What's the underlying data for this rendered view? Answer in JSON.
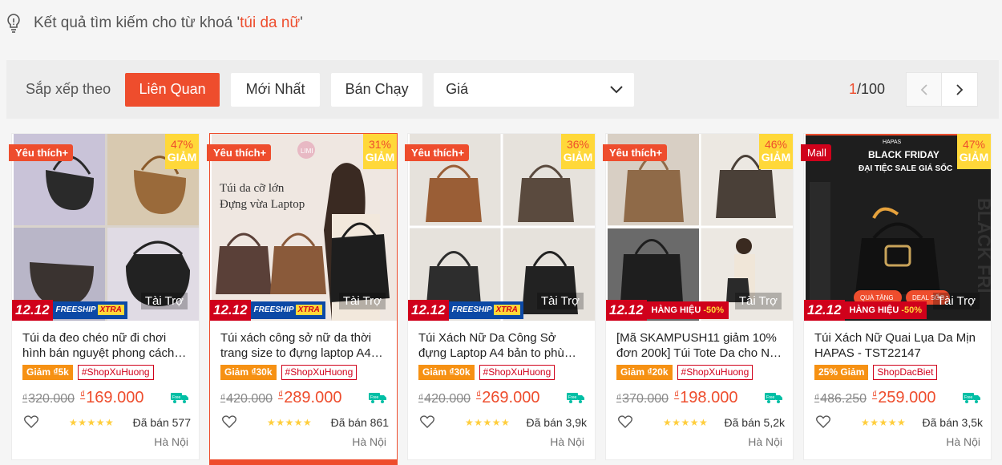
{
  "search_hint": {
    "prefix": "Kết quả tìm kiếm cho từ khoá '",
    "keyword": "túi da nữ",
    "suffix": "'"
  },
  "sortbar": {
    "label": "Sắp xếp theo",
    "options": [
      "Liên Quan",
      "Mới Nhất",
      "Bán Chạy"
    ],
    "active": "Liên Quan",
    "price_select": "Giá",
    "pager_current": "1",
    "pager_total": "/100"
  },
  "colors": {
    "accent": "#ee4d2d",
    "mall": "#d0011b",
    "discount_badge": "#ffd839",
    "voucher": "#f69113"
  },
  "products": [
    {
      "badge": "Yêu thích+",
      "discount_pct": "47%",
      "discount_word": "GIẢM",
      "sponsor": "Tài Trợ",
      "promo": "12.12",
      "promo2": "FREESHIP",
      "promo2b": "XTRA",
      "name": "Túi da đeo chéo nữ đi chơi hình bán nguyệt phong cách…",
      "tag_discount": "Giảm ₫5k",
      "tag_shop": "#ShopXuHuong",
      "currency": "₫",
      "old_price": "320.000",
      "new_price": "169.000",
      "stars": "★★★★★",
      "sold": "Đã bán 577",
      "location": "Hà Nội"
    },
    {
      "badge": "Yêu thích+",
      "discount_pct": "31%",
      "discount_word": "GIẢM",
      "sponsor": "Tài Trợ",
      "promo": "12.12",
      "promo2": "FREESHIP",
      "promo2b": "XTRA",
      "name": "Túi xách công sở nữ da thời trang size to đựng laptop A4…",
      "tag_discount": "Giảm ₫30k",
      "tag_shop": "#ShopXuHuong",
      "currency": "₫",
      "old_price": "420.000",
      "new_price": "289.000",
      "stars": "★★★★★",
      "sold": "Đã bán 861",
      "location": "Hà Nội",
      "image_text": [
        "Túi da cỡ lớn",
        "Đựng vừa Laptop"
      ]
    },
    {
      "badge": "Yêu thích+",
      "discount_pct": "36%",
      "discount_word": "GIẢM",
      "sponsor": "Tài Trợ",
      "promo": "12.12",
      "promo2": "FREESHIP",
      "promo2b": "XTRA",
      "name": "Túi Xách Nữ Da Công Sở đựng Laptop A4 bản to phù…",
      "tag_discount": "Giảm ₫30k",
      "tag_shop": "#ShopXuHuong",
      "currency": "₫",
      "old_price": "420.000",
      "new_price": "269.000",
      "stars": "★★★★★",
      "sold": "Đã bán 3,9k",
      "location": "Hà Nội"
    },
    {
      "badge": "Yêu thích+",
      "discount_pct": "46%",
      "discount_word": "GIẢM",
      "sponsor": "Tài Trợ",
      "promo": "12.12",
      "promo2": "HÀNG HIỆU",
      "promo2b": "-50%",
      "name": "[Mã SKAMPUSH11 giảm 10% đơn 200k] Túi Tote Da cho N…",
      "tag_discount": "Giảm ₫20k",
      "tag_shop": "#ShopXuHuong",
      "currency": "₫",
      "old_price": "370.000",
      "new_price": "198.000",
      "stars": "★★★★★",
      "sold": "Đã bán 5,2k",
      "location": "Hà Nội"
    },
    {
      "badge": "Mall",
      "discount_pct": "47%",
      "discount_word": "GIẢM",
      "sponsor": "Tài Trợ",
      "promo": "12.12",
      "promo2": "HÀNG HIỆU",
      "promo2b": "-50%",
      "name": "Túi Xách Nữ Quai Lụa Da Mịn HAPAS - TST22147",
      "tag_discount": "25% Giảm",
      "tag_shop": "ShopDacBiet",
      "currency": "₫",
      "old_price": "486.250",
      "new_price": "259.000",
      "stars": "★★★★★",
      "sold": "Đã bán 3,5k",
      "location": "Hà Nội",
      "image_text": [
        "HAPAS",
        "BLACK FRIDAY",
        "ĐẠI TIỆC SALE GIÁ SỐC",
        "BLACK FRI",
        "QUÀ TẶNG",
        "DEAL SỐC"
      ]
    }
  ]
}
